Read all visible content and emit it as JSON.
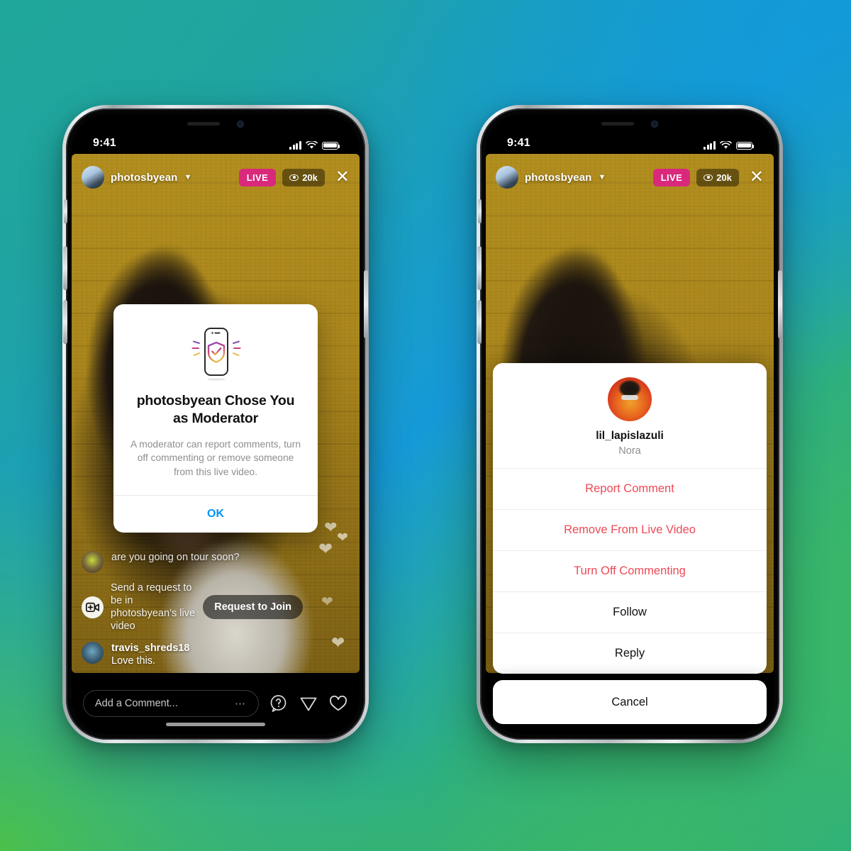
{
  "background": {
    "gradient_from": "#20a79c",
    "gradient_to": "#4ec243",
    "accent_blue": "#169ad8",
    "accent_green": "#2fb07c"
  },
  "status_bar": {
    "time": "9:41",
    "cellular_icon": "signal-bars-icon",
    "wifi_icon": "wifi-icon",
    "battery_icon": "battery-icon"
  },
  "live_header": {
    "avatar_icon": "host-avatar",
    "username": "photosbyean",
    "chevron_icon": "chevron-down-icon",
    "live_label": "LIVE",
    "viewer_icon": "eye-icon",
    "viewer_count": "20k",
    "close_icon": "close-icon"
  },
  "comments": [
    {
      "name": "",
      "text": "are you going on tour soon?",
      "avatar": "commenter-avatar-1"
    },
    {
      "name": "",
      "text": "Send a request to be in photosbyean’s live video",
      "avatar": "request-join-icon",
      "button": "Request to Join"
    },
    {
      "name": "travis_shreds18",
      "text": "Love this.",
      "avatar": "commenter-avatar-5"
    }
  ],
  "bottom_bar": {
    "comment_placeholder": "Add a Comment...",
    "more_icon": "more-dots-icon",
    "question_icon": "question-bubble-icon",
    "send_icon": "paper-plane-icon",
    "heart_icon": "heart-icon"
  },
  "moderator_dialog": {
    "illustration_icon": "phone-shield-check-icon",
    "title": "photosbyean Chose You as Moderator",
    "body": "A moderator can report comments, turn off commenting or remove someone from this live video.",
    "ok_label": "OK",
    "ok_color": "#0095f6"
  },
  "action_sheet": {
    "avatar_icon": "commenter-avatar",
    "username": "lil_lapislazuli",
    "display_name": "Nora",
    "danger_color": "#ed4956",
    "options": [
      {
        "label": "Report Comment",
        "style": "danger"
      },
      {
        "label": "Remove From Live Video",
        "style": "danger"
      },
      {
        "label": "Turn Off Commenting",
        "style": "danger"
      },
      {
        "label": "Follow",
        "style": "neutral"
      },
      {
        "label": "Reply",
        "style": "neutral"
      }
    ],
    "cancel_label": "Cancel"
  }
}
